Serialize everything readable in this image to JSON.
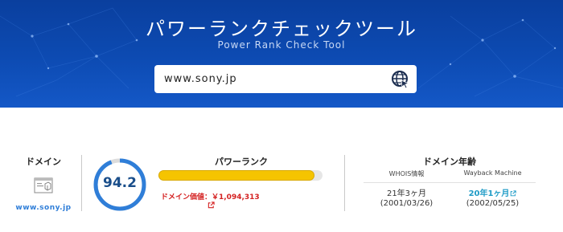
{
  "hero": {
    "title": "パワーランクチェックツール",
    "subtitle": "Power Rank Check Tool"
  },
  "search": {
    "value": "www.sony.jp",
    "button_icon": "globe-cursor-icon"
  },
  "domain": {
    "label": "ドメイン",
    "thumbnail_icon": "site-thumbnail-icon",
    "link_text": "www.sony.jp"
  },
  "score": {
    "value": "94.2",
    "fraction": 0.942
  },
  "power_rank": {
    "label": "パワーランク",
    "bar_fraction": 0.95,
    "value_text": "ドメイン価値：￥1,094,313",
    "link_icon": "external-link-icon"
  },
  "domain_age": {
    "label": "ドメイン年齢",
    "columns": [
      {
        "header": "WHOIS情報",
        "age": "21年3ヶ月",
        "date": "(2001/03/26)",
        "is_link": false
      },
      {
        "header": "Wayback Machine",
        "age": "20年1ヶ月",
        "date": "(2002/05/25)",
        "is_link": true
      }
    ]
  },
  "colors": {
    "hero_bg": "#0d4bb3",
    "gauge": "#2f7ed8",
    "bar_fill": "#f5c400",
    "value_red": "#d42020",
    "link_blue": "#1e9bc6"
  }
}
